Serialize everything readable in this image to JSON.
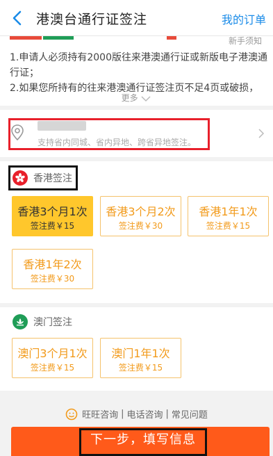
{
  "header": {
    "title": "港澳台通行证签注",
    "orders_label": "我的订单"
  },
  "notice": {
    "must_read": "新手须知",
    "line1": "1.申请人必须持有2000版往来港澳通行证或新版电子港澳通行证；",
    "line2": "2.如果您所持有的往来港澳通行证签注页不足4页或破损，",
    "more_label": "更多"
  },
  "location": {
    "hint": "支持省内同城、省内异地、跨省异地签注。"
  },
  "hongkong": {
    "section_label": "香港签注",
    "options": [
      {
        "name": "香港3个月1次",
        "fee": "签注费￥15",
        "selected": true
      },
      {
        "name": "香港3个月2次",
        "fee": "签注费￥30",
        "selected": false
      },
      {
        "name": "香港1年1次",
        "fee": "签注费￥15",
        "selected": false
      },
      {
        "name": "香港1年2次",
        "fee": "签注费￥30",
        "selected": false
      }
    ]
  },
  "macau": {
    "section_label": "澳门签注",
    "options": [
      {
        "name": "澳门3个月1次",
        "fee": "签注费￥15",
        "selected": false
      },
      {
        "name": "澳门1年1次",
        "fee": "签注费￥15",
        "selected": false
      }
    ]
  },
  "consult": {
    "wangwang": "旺旺咨询",
    "phone": "电话咨询",
    "faq": "常见问题",
    "separator": "|"
  },
  "next_button": "下一步，填写信息",
  "colors": {
    "accent_blue": "#1a8be8",
    "option_orange": "#f29a1a",
    "selected_yellow": "#ffc72c",
    "cta_orange": "#ff5a1a",
    "highlight_red": "#e8202b"
  },
  "icons": {
    "back": "chevron-left-icon",
    "location": "map-pin-icon",
    "hongkong": "hongkong-flower-icon",
    "macau": "macau-lotus-icon",
    "consult": "smile-icon",
    "more": "chevron-down-icon",
    "arrow": "chevron-right-icon"
  }
}
